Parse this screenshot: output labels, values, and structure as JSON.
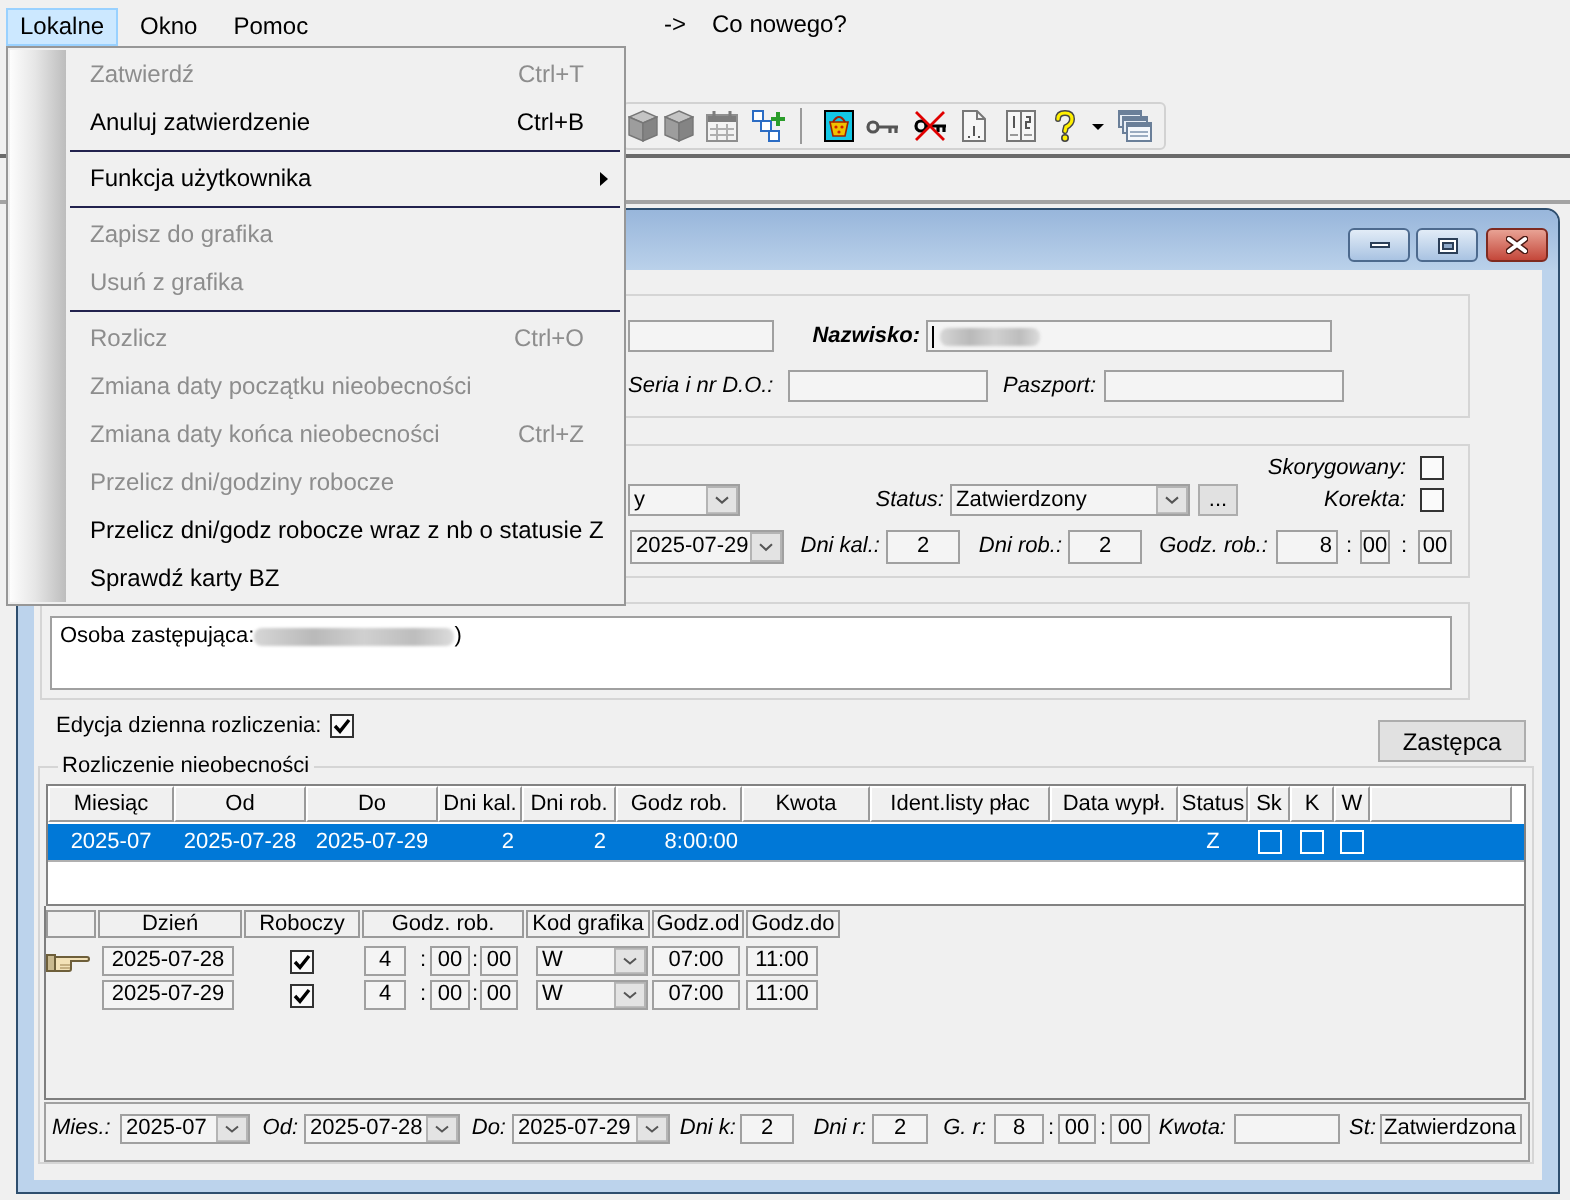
{
  "menubar": {
    "items": [
      {
        "label": "Lokalne",
        "selected": true
      },
      {
        "label": "Okno",
        "selected": false
      },
      {
        "label": "Pomoc",
        "selected": false
      }
    ],
    "arrow": "->",
    "link": "Co nowego?"
  },
  "toolbar": {
    "buttons": [
      {
        "kind": "box",
        "disabled": true
      },
      {
        "kind": "box",
        "disabled": true
      },
      {
        "kind": "calendar",
        "disabled": true
      },
      {
        "kind": "add-link",
        "disabled": false
      },
      {
        "kind": "separator"
      },
      {
        "kind": "basket",
        "disabled": false
      },
      {
        "kind": "key",
        "disabled": false
      },
      {
        "kind": "no-key",
        "disabled": false
      },
      {
        "kind": "page-one",
        "disabled": false
      },
      {
        "kind": "page-two",
        "disabled": false
      },
      {
        "kind": "help",
        "disabled": false
      },
      {
        "kind": "dropdown"
      },
      {
        "kind": "windows",
        "disabled": false
      }
    ]
  },
  "menu": {
    "items": [
      {
        "kind": "item",
        "label": "Zatwierdź",
        "shortcut": "Ctrl+T",
        "disabled": true
      },
      {
        "kind": "item",
        "label": "Anuluj zatwierdzenie",
        "shortcut": "Ctrl+B",
        "disabled": false
      },
      {
        "kind": "separator"
      },
      {
        "kind": "submenu",
        "label": "Funkcja użytkownika",
        "disabled": false
      },
      {
        "kind": "separator"
      },
      {
        "kind": "item",
        "label": "Zapisz do grafika",
        "disabled": true
      },
      {
        "kind": "item",
        "label": "Usuń z grafika",
        "disabled": true
      },
      {
        "kind": "separator"
      },
      {
        "kind": "item",
        "label": "Rozlicz",
        "shortcut": "Ctrl+O",
        "disabled": true
      },
      {
        "kind": "item",
        "label": "Zmiana daty początku nieobecności",
        "disabled": true
      },
      {
        "kind": "item",
        "label": "Zmiana daty końca nieobecności",
        "shortcut": "Ctrl+Z",
        "disabled": true
      },
      {
        "kind": "item",
        "label": "Przelicz dni/godziny robocze",
        "disabled": true
      },
      {
        "kind": "item",
        "label": "Przelicz dni/godz robocze wraz z nb o statusie Z",
        "disabled": false
      },
      {
        "kind": "item",
        "label": "Sprawdź karty BZ",
        "disabled": false
      }
    ]
  },
  "person": {
    "surname_label": "Nazwisko:",
    "surname": {
      "focused": true,
      "blurred": true
    },
    "id_label": "Seria i nr D.O.:",
    "passport_label": "Paszport:"
  },
  "absence": {
    "type_value": "y",
    "status_label": "Status:",
    "status": "Zatwierdzony",
    "status_more": "...",
    "corrected_label": "Skorygowany:",
    "corrected": false,
    "correction_label": "Korekta:",
    "correction": false,
    "to_date": "2025-07-29",
    "cal_days_label": "Dni kal.:",
    "cal_days": "2",
    "work_days_label": "Dni rob.:",
    "work_days": "2",
    "hours_label": "Godz. rob.:",
    "hours": [
      "8",
      "00",
      "00"
    ],
    "separators": [
      ":",
      ":"
    ]
  },
  "notes": {
    "text": "Osoba zastępująca:",
    "blurred": true,
    "text_after": ")"
  },
  "daily_edit": {
    "label": "Edycja dzienna rozliczenia:",
    "checked": true
  },
  "deputy_button": {
    "label": "Zastępca"
  },
  "settlement": {
    "title": "Rozliczenie nieobecności",
    "columns": [
      {
        "label": "Miesiąc",
        "kind": "text"
      },
      {
        "label": "Od",
        "kind": "text"
      },
      {
        "label": "Do",
        "kind": "text"
      },
      {
        "label": "Dni kal.",
        "kind": "text"
      },
      {
        "label": "Dni rob.",
        "kind": "text"
      },
      {
        "label": "Godz rob.",
        "kind": "text"
      },
      {
        "label": "Kwota",
        "kind": "text"
      },
      {
        "label": "Ident.listy płac",
        "kind": "text"
      },
      {
        "label": "Data wypł.",
        "kind": "text"
      },
      {
        "label": "Status",
        "kind": "text"
      },
      {
        "label": "Sk",
        "kind": "check"
      },
      {
        "label": "K",
        "kind": "check"
      },
      {
        "label": "W",
        "kind": "check"
      }
    ],
    "rows": [
      {
        "selected": true,
        "cells": [
          "2025-07",
          "2025-07-28",
          "2025-07-29",
          "2",
          "2",
          "8:00:00",
          null,
          null,
          null,
          "Z"
        ],
        "flags": [
          false,
          false,
          false
        ]
      }
    ]
  },
  "daily": {
    "columns": [
      "Dzień",
      "Roboczy",
      "Godz. rob.",
      "Kod grafika",
      "Godz.od",
      "Godz.do"
    ],
    "rows": [
      {
        "selected": true,
        "date": "2025-07-28",
        "working": true,
        "hours": [
          "4",
          "00",
          "00"
        ],
        "separators": [
          ":",
          ":"
        ],
        "code": "W",
        "from": "07:00",
        "to": "11:00"
      },
      {
        "selected": false,
        "date": "2025-07-29",
        "working": true,
        "hours": [
          "4",
          "00",
          "00"
        ],
        "separators": [
          ":",
          ":"
        ],
        "code": "W",
        "from": "07:00",
        "to": "11:00"
      }
    ]
  },
  "summary": {
    "month_label": "Mies.:",
    "month": "2025-07",
    "from_label": "Od:",
    "from": "2025-07-28",
    "to_label": "Do:",
    "to": "2025-07-29",
    "cal_days_label": "Dni k:",
    "cal_days": "2",
    "work_days_label": "Dni r:",
    "work_days": "2",
    "hours_label": "G. r:",
    "hours": [
      "8",
      "00",
      "00"
    ],
    "separators": [
      ":",
      ":"
    ],
    "amount_label": "Kwota:",
    "status_label": "St:",
    "status": "Zatwierdzona"
  }
}
